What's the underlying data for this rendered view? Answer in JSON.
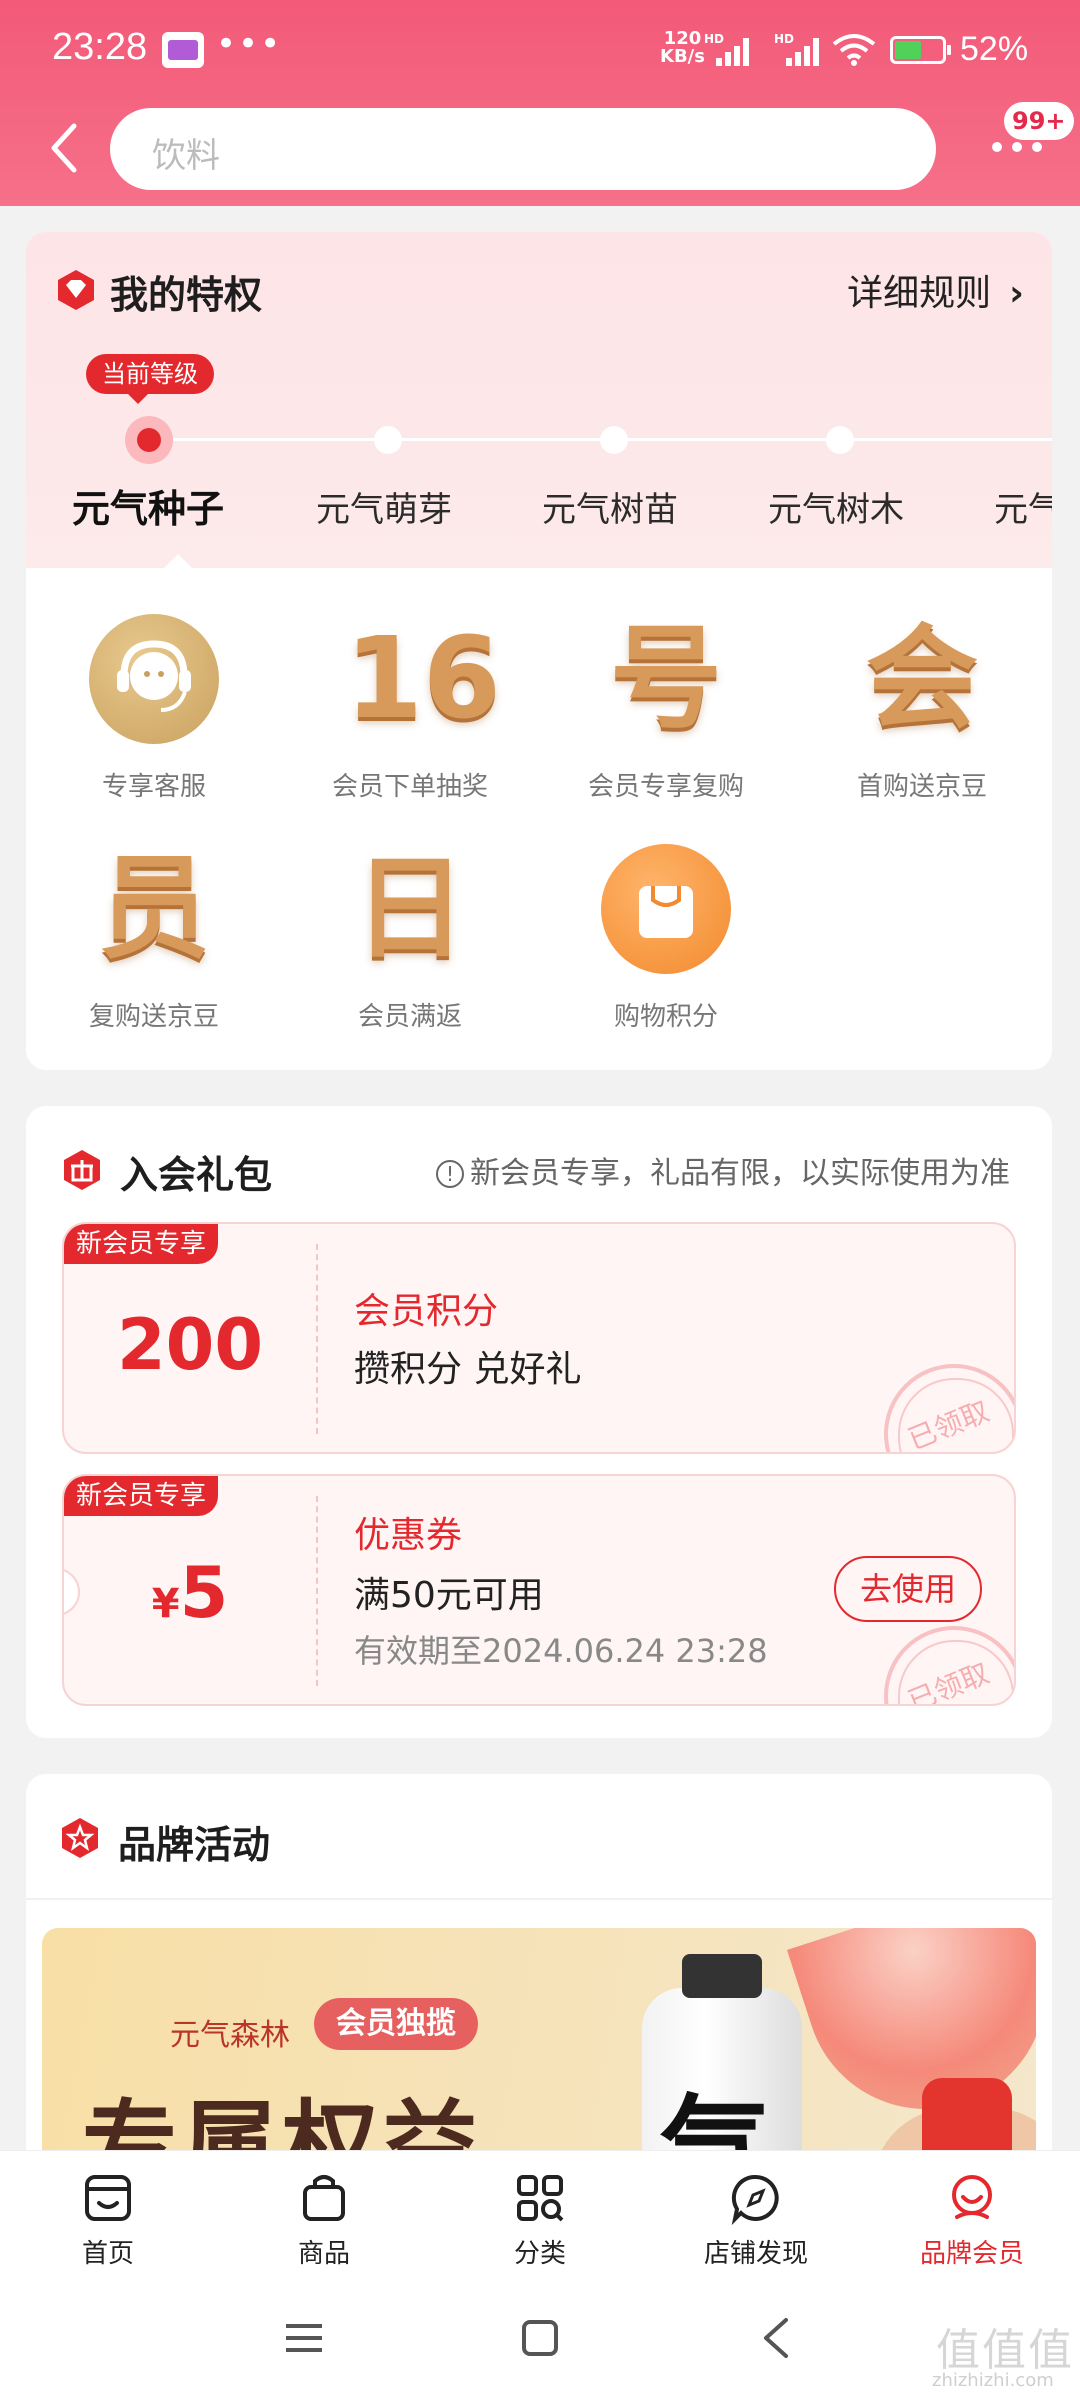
{
  "status_bar": {
    "time": "23:28",
    "dots": "•••",
    "net_speed_value": "120",
    "net_speed_unit": "KB/s",
    "hd1": "HD",
    "hd2": "HD",
    "battery": "52%"
  },
  "header": {
    "search_placeholder": "饮料",
    "badge": "99+"
  },
  "privilege": {
    "title": "我的特权",
    "rules_link": "详细规则",
    "current_tag": "当前等级",
    "levels": [
      "元气种子",
      "元气萌芽",
      "元气树苗",
      "元气树木",
      "元气"
    ],
    "perks": [
      {
        "label": "专享客服",
        "icon": "headset-icon"
      },
      {
        "label": "会员下单抽奖",
        "glyph": "16"
      },
      {
        "label": "会员专享复购",
        "glyph": "号"
      },
      {
        "label": "首购送京豆",
        "glyph": "会"
      },
      {
        "label": "复购送京豆",
        "glyph": "员"
      },
      {
        "label": "会员满返",
        "glyph": "日"
      },
      {
        "label": "购物积分",
        "icon": "shopping-bag-icon"
      }
    ]
  },
  "gift": {
    "title": "入会礼包",
    "note": "新会员专享，礼品有限，以实际使用为准",
    "coupons": [
      {
        "tag": "新会员专享",
        "value": "200",
        "title": "会员积分",
        "subtitle": "攒积分 兑好礼",
        "stamp": "已领取"
      },
      {
        "tag": "新会员专享",
        "currency": "¥",
        "value": "5",
        "title": "优惠券",
        "subtitle": "满50元可用",
        "expiry": "有效期至2024.06.24 23:28",
        "button": "去使用",
        "stamp": "已领取"
      }
    ]
  },
  "brand": {
    "title": "品牌活动",
    "banner": {
      "brand_name": "元气森林",
      "pill": "会员独揽",
      "headline": "专属权益",
      "bottle_glyph": "气"
    }
  },
  "bottom_nav": {
    "tabs": [
      {
        "label": "首页"
      },
      {
        "label": "商品"
      },
      {
        "label": "分类"
      },
      {
        "label": "店铺发现"
      },
      {
        "label": "品牌会员"
      }
    ]
  },
  "watermark": {
    "main": "值值值",
    "sub": "zhizhizhi.com"
  },
  "colors": {
    "accent": "#e4292e",
    "header": "#f25a78",
    "gold": "#d79a5a"
  }
}
